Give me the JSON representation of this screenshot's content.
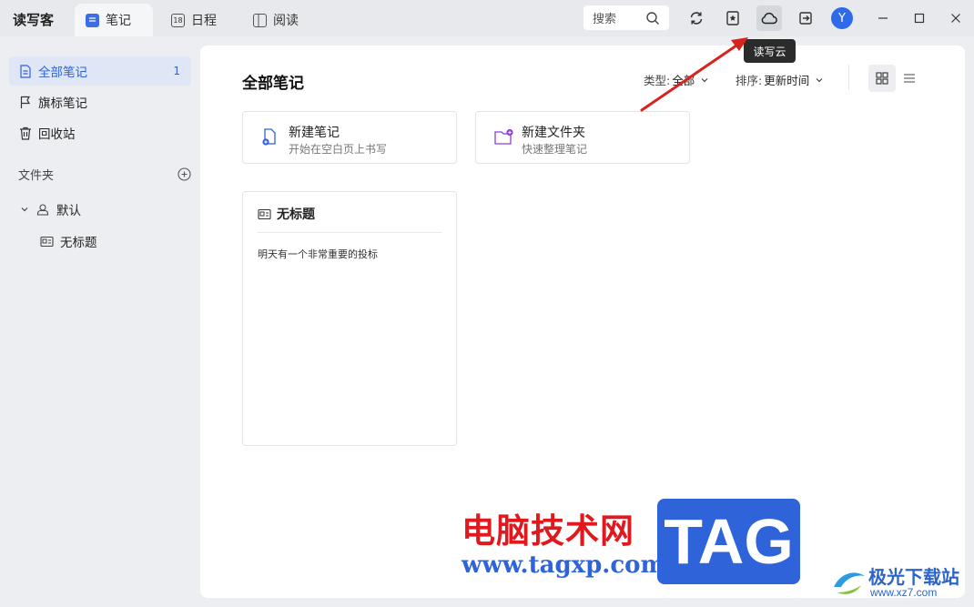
{
  "app": {
    "name": "读写客"
  },
  "tabs": [
    {
      "label": "笔记",
      "icon": "notes-icon",
      "active": true
    },
    {
      "label": "日程",
      "icon": "calendar-icon",
      "icon_text": "18"
    },
    {
      "label": "阅读",
      "icon": "book-icon"
    }
  ],
  "toolbar": {
    "search_label": "搜索",
    "avatar_letter": "Y",
    "tooltip": "读写云"
  },
  "sidebar": {
    "items": [
      {
        "label": "全部笔记",
        "count": "1",
        "icon": "document-icon",
        "active": true
      },
      {
        "label": "旗标笔记",
        "icon": "flag-icon"
      },
      {
        "label": "回收站",
        "icon": "trash-icon"
      }
    ],
    "folder_header": "文件夹",
    "tree": [
      {
        "label": "默认",
        "icon": "folder-user-icon"
      },
      {
        "label": "无标题",
        "icon": "note-card-icon"
      }
    ]
  },
  "main": {
    "title": "全部笔记",
    "filter_type_label": "类型:",
    "filter_type_value": "全部",
    "sort_label": "排序:",
    "sort_value": "更新时间",
    "actions": [
      {
        "title": "新建笔记",
        "subtitle": "开始在空白页上书写",
        "icon": "new-note-icon"
      },
      {
        "title": "新建文件夹",
        "subtitle": "快速整理笔记",
        "icon": "new-folder-icon"
      }
    ],
    "notes": [
      {
        "title": "无标题",
        "body": "明天有一个非常重要的投标"
      }
    ]
  },
  "watermark": {
    "cn": "电脑技术网",
    "url": "www.tagxp.com",
    "tag": "TAG",
    "jg": "极光下载站",
    "jg_url": "www.xz7.com"
  },
  "colors": {
    "accent": "#2f62d8",
    "titlebar": "#e7e9ec",
    "arrow": "#d8231f",
    "tooltip_bg": "#2b2b2b"
  }
}
